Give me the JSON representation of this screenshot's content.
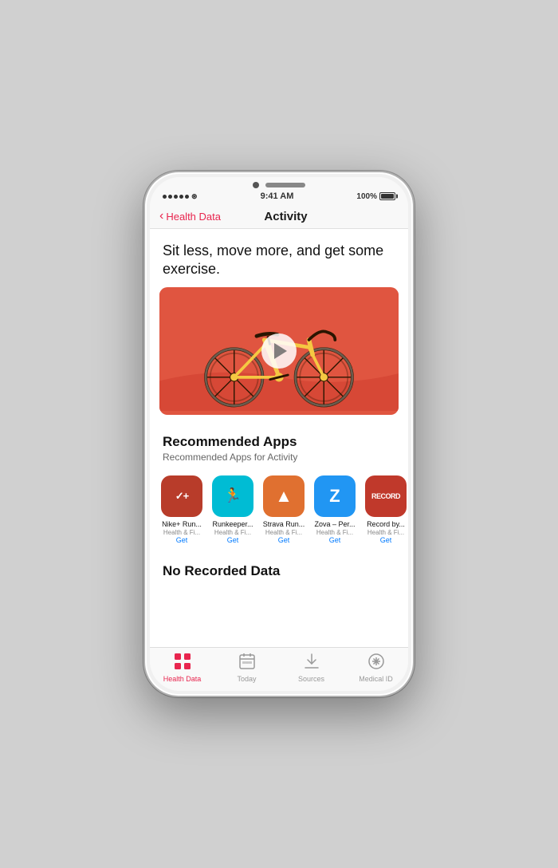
{
  "status_bar": {
    "signal": "●●●●●",
    "wifi": "WiFi",
    "time": "9:41 AM",
    "battery": "100%"
  },
  "nav": {
    "back_label": "Health Data",
    "title": "Activity"
  },
  "content": {
    "tagline": "Sit less, move more, and get some exercise.",
    "recommended": {
      "title": "Recommended Apps",
      "subtitle": "Recommended Apps for Activity",
      "apps": [
        {
          "name": "Nike+ Run...",
          "category": "Health & Fi...",
          "action": "Get",
          "icon_label": "nike-icon",
          "icon_color": "#b83c2a",
          "icon_text": "✓+"
        },
        {
          "name": "Runkeeper...",
          "category": "Health & Fi...",
          "action": "Get",
          "icon_label": "runkeeper-icon",
          "icon_color": "#00bcd4",
          "icon_text": "🏃"
        },
        {
          "name": "Strava Run...",
          "category": "Health & Fi...",
          "action": "Get",
          "icon_label": "strava-icon",
          "icon_color": "#e07030",
          "icon_text": "▲"
        },
        {
          "name": "Zova – Per...",
          "category": "Health & Fi...",
          "action": "Get",
          "icon_label": "zova-icon",
          "icon_color": "#2196f3",
          "icon_text": "Z"
        },
        {
          "name": "Record by...",
          "category": "Health & Fi...",
          "action": "Get",
          "icon_label": "record-icon",
          "icon_color": "#c0392b",
          "icon_text": "REC"
        }
      ]
    },
    "no_data_label": "No Recorded Data"
  },
  "tab_bar": {
    "tabs": [
      {
        "label": "Health Data",
        "icon": "grid",
        "active": true
      },
      {
        "label": "Today",
        "icon": "calendar",
        "active": false
      },
      {
        "label": "Sources",
        "icon": "download",
        "active": false
      },
      {
        "label": "Medical ID",
        "icon": "asterisk",
        "active": false
      }
    ]
  }
}
